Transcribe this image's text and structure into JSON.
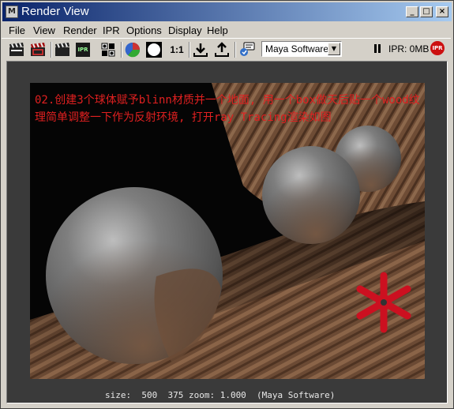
{
  "window": {
    "title": "Render View",
    "icon_label": "M"
  },
  "title_buttons": {
    "minimize": "_",
    "maximize": "□",
    "close": "×"
  },
  "menu": [
    "File",
    "View",
    "Render",
    "IPR",
    "Options",
    "Display",
    "Help"
  ],
  "toolbar": {
    "ipr_label": "IPR",
    "ratio_label": "1:1",
    "renderer": "Maya Software",
    "ipr_status": "IPR: 0MB",
    "ipr_badge": "IPR"
  },
  "render_caption": "02.创建3个球体赋予blinn材质并一个地面, 用一个box做天后贴一个wood纹理简单调整一下作为反射环境, 打开ray Tracing渲染如图",
  "render_status": "size:  500  375 zoom: 1.000  (Maya Software)",
  "colors": {
    "caption": "#e02020",
    "logo": "#cc1020",
    "title_start": "#0a246a",
    "title_end": "#a6caf0"
  }
}
